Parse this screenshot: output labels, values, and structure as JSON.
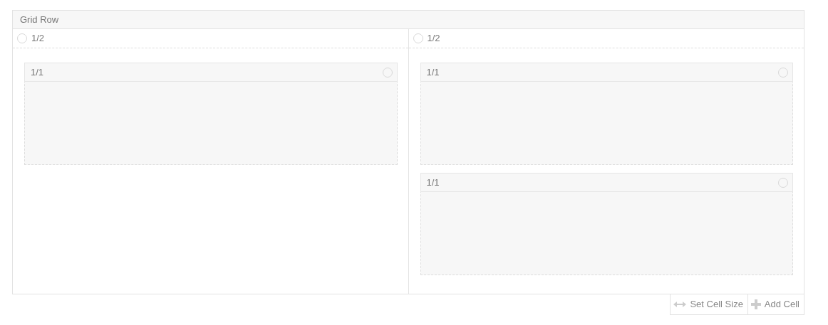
{
  "row": {
    "title": "Grid Row"
  },
  "columns": [
    {
      "label": "1/2",
      "selected": false,
      "cells": [
        {
          "label": "1/1",
          "selected": false
        }
      ]
    },
    {
      "label": "1/2",
      "selected": false,
      "cells": [
        {
          "label": "1/1",
          "selected": false
        },
        {
          "label": "1/1",
          "selected": false
        }
      ]
    }
  ],
  "actions": [
    {
      "kind": "resize",
      "label": "Set Cell Size"
    },
    {
      "kind": "add",
      "label": "Add Cell"
    }
  ]
}
